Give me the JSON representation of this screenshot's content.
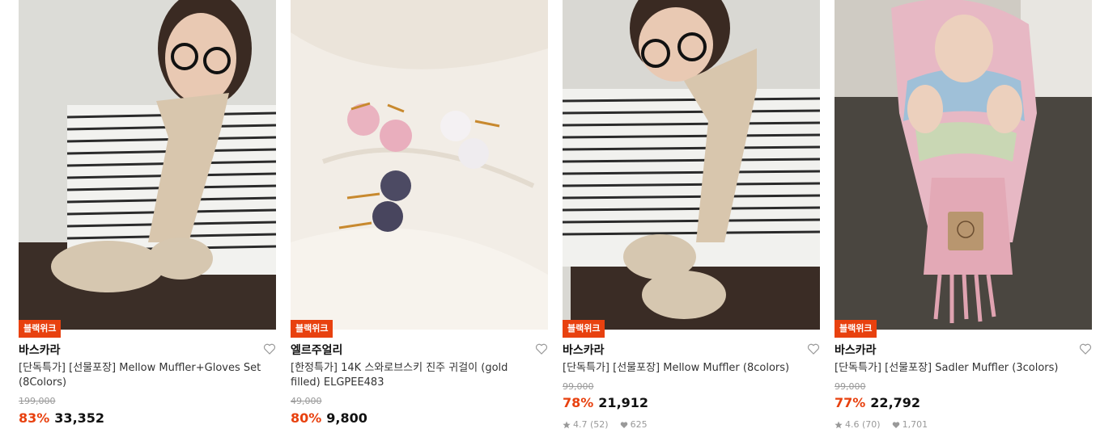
{
  "products": [
    {
      "badge": "블랙위크",
      "brand": "바스카라",
      "name": "[단독특가] [선물포장] Mellow Muffler+Gloves Set (8Colors)",
      "original_price": "199,000",
      "discount": "83%",
      "sale_price": "33,352",
      "image_icon": "scarf-gloves-model-photo"
    },
    {
      "badge": "블랙위크",
      "brand": "엘르주얼리",
      "name": "[한정특가] 14K 스와로브스키 진주 귀걸이 (gold filled) ELGPEE483",
      "original_price": "49,000",
      "discount": "80%",
      "sale_price": "9,800",
      "image_icon": "pearl-earrings-photo"
    },
    {
      "badge": "블랙위크",
      "brand": "바스카라",
      "name": "[단독특가] [선물포장] Mellow Muffler (8colors)",
      "original_price": "99,000",
      "discount": "78%",
      "sale_price": "21,912",
      "rating": "4.7",
      "reviews": "(52)",
      "likes": "625",
      "image_icon": "muffler-model-photo"
    },
    {
      "badge": "블랙위크",
      "brand": "바스카라",
      "name": "[단독특가] [선물포장] Sadler Muffler (3colors)",
      "original_price": "99,000",
      "discount": "77%",
      "sale_price": "22,792",
      "rating": "4.6",
      "reviews": "(70)",
      "likes": "1,701",
      "image_icon": "sadler-muffler-model-photo"
    }
  ],
  "colors": {
    "accent": "#e8410f",
    "muted": "#999999",
    "text": "#111111"
  }
}
